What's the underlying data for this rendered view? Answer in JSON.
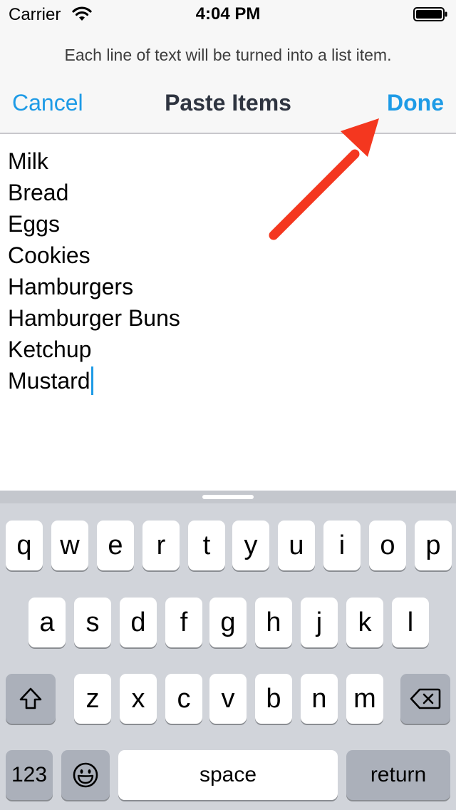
{
  "status_bar": {
    "carrier": "Carrier",
    "time": "4:04 PM",
    "icons": [
      "wifi-icon",
      "battery-icon"
    ]
  },
  "header": {
    "prompt": "Each line of text will be turned into a list item.",
    "cancel_label": "Cancel",
    "title": "Paste Items",
    "done_label": "Done"
  },
  "text_area": {
    "lines": [
      "Milk",
      "Bread",
      "Eggs",
      "Cookies",
      "Hamburgers",
      "Hamburger Buns",
      "Ketchup",
      "Mustard"
    ]
  },
  "keyboard": {
    "row1": [
      "q",
      "w",
      "e",
      "r",
      "t",
      "y",
      "u",
      "i",
      "o",
      "p"
    ],
    "row2": [
      "a",
      "s",
      "d",
      "f",
      "g",
      "h",
      "j",
      "k",
      "l"
    ],
    "row3": [
      "z",
      "x",
      "c",
      "v",
      "b",
      "n",
      "m"
    ],
    "numbers_label": "123",
    "space_label": "space",
    "return_label": "return",
    "icons": [
      "shift-icon",
      "backspace-icon",
      "emoji-icon"
    ]
  },
  "colors": {
    "accent": "#1e9be6",
    "annotation_arrow": "#f4371f",
    "keyboard_bg": "#d1d4da"
  }
}
